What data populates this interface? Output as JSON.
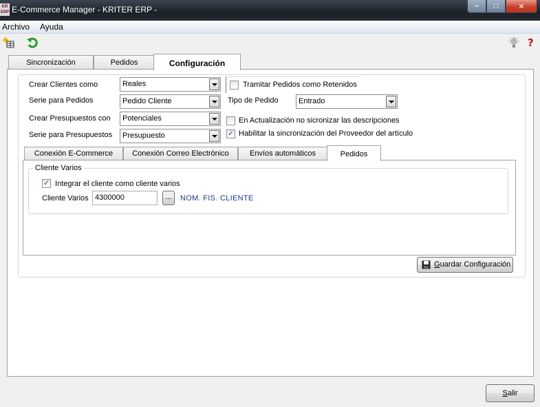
{
  "window": {
    "title": "E-Commerce Manager - KRITER ERP -",
    "app_icon_text": "KR ERP",
    "minimize": "–",
    "maximize": "□",
    "close": "✕"
  },
  "menu": [
    "Archivo",
    "Ayuda"
  ],
  "tabs": [
    "Sincronización",
    "Pedidos",
    "Configuración"
  ],
  "config": {
    "crear_clientes_label": "Crear Clientes como",
    "crear_clientes_value": "Reales",
    "serie_pedidos_label": "Serie para Pedidos",
    "serie_pedidos_value": "Pedido Cliente",
    "crear_presupuestos_label": "Crear Presupuestos con",
    "crear_presupuestos_value": "Potenciales",
    "serie_presupuestos_label": "Serie para Presupuestos",
    "serie_presupuestos_value": "Presupuesto",
    "tramitar_label": "Tramitar Pedidos como Retenidos",
    "tramitar_checked": false,
    "tipo_pedido_label": "Tipo de Pedido",
    "tipo_pedido_value": "Entrado",
    "actualizacion_label": "En Actualización no sicronizar las descripciones",
    "actualizacion_checked": false,
    "habilitar_label": "Habilitar la sincronización del Proveedor del artículo",
    "habilitar_checked": true
  },
  "inner_tabs": [
    "Conexión E-Commerce",
    "Conexión Correo Electrónico",
    "Envíos automáticos",
    "Pedidos"
  ],
  "pedidos_tab": {
    "group_title": "Cliente Varios",
    "integrar_label": "Integrar el cliente como cliente varios",
    "integrar_checked": true,
    "cliente_varios_label": "Cliente Varios",
    "cliente_varios_value": "4300000",
    "browse_label": "...",
    "cliente_nombre": "NOM. FIS. CLIENTE"
  },
  "buttons": {
    "guardar_prefix": "",
    "guardar_underline": "G",
    "guardar_rest": "uardar Configuración",
    "salir_underline": "S",
    "salir_rest": "alir"
  },
  "check_mark": "✓",
  "colors": {
    "link": "#1a3c8c",
    "titlebar": "#1a2026"
  }
}
